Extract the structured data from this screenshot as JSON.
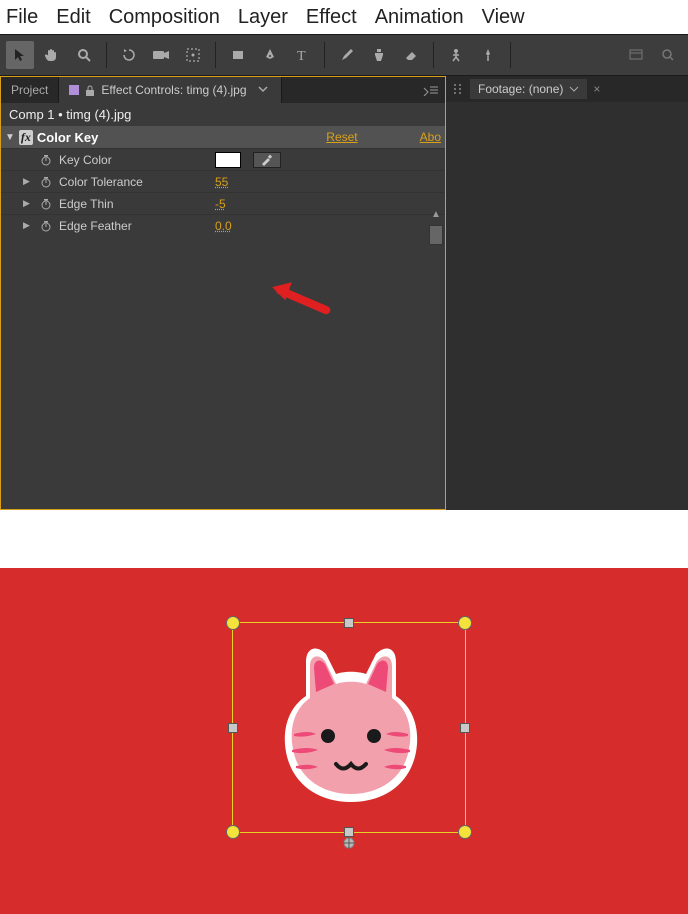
{
  "menu": {
    "file": "File",
    "edit": "Edit",
    "composition": "Composition",
    "layer": "Layer",
    "effect": "Effect",
    "animation": "Animation",
    "view": "View"
  },
  "tabs": {
    "project": "Project",
    "effect_controls_prefix": "Effect Controls: ",
    "effect_controls_file": "timg (4).jpg"
  },
  "breadcrumb": "Comp 1 • timg (4).jpg",
  "effect": {
    "name": "Color Key",
    "reset": "Reset",
    "about": "Abo",
    "props": {
      "key_color": {
        "label": "Key Color"
      },
      "color_tolerance": {
        "label": "Color Tolerance",
        "value": "55"
      },
      "edge_thin": {
        "label": "Edge Thin",
        "value": "-5"
      },
      "edge_feather": {
        "label": "Edge Feather",
        "value": "0.0"
      }
    }
  },
  "right_panel": {
    "footage_label": "Footage: (none)"
  },
  "colors": {
    "accent": "#d8a017",
    "preview_bg": "#d62c2c"
  }
}
